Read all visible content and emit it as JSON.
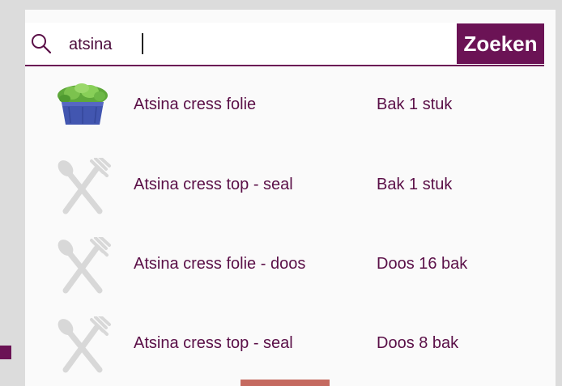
{
  "search": {
    "value": "atsina",
    "button_label": "Zoeken"
  },
  "results": [
    {
      "name": "Atsina cress folie",
      "unit": "Bak 1 stuk",
      "thumbnail": "cress-tray-photo"
    },
    {
      "name": "Atsina cress top - seal",
      "unit": "Bak 1 stuk",
      "thumbnail": "cutlery-placeholder-icon"
    },
    {
      "name": "Atsina cress folie - doos",
      "unit": "Doos 16 bak",
      "thumbnail": "cutlery-placeholder-icon"
    },
    {
      "name": "Atsina cress top - seal",
      "unit": "Doos 8 bak",
      "thumbnail": "cutlery-placeholder-icon"
    }
  ],
  "colors": {
    "brand": "#6b1355",
    "text": "#5a0f47",
    "placeholder_icon": "#d8d8d8"
  }
}
